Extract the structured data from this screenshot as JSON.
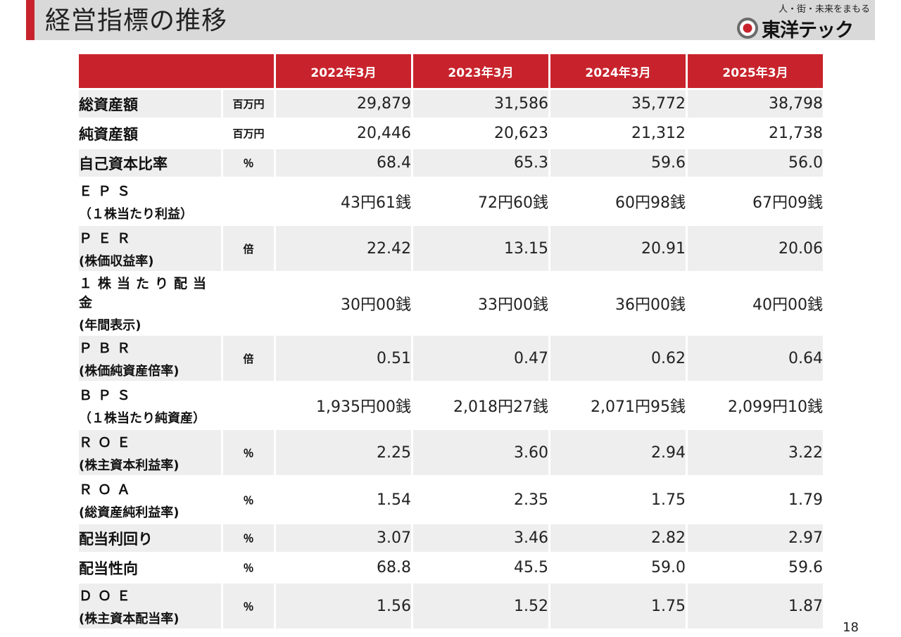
{
  "title": "経営指標の推移",
  "logo": {
    "slogan": "人・街・未来をまもる",
    "company": "東洋テック",
    "icon": "toyotec-logo-mark"
  },
  "colors": {
    "accent": "#c8232c",
    "header_bar": "#d9d9d9",
    "row_shade": "#eeeeee"
  },
  "table": {
    "headers": [
      "2022年3月",
      "2023年3月",
      "2024年3月",
      "2025年3月"
    ],
    "rows": [
      {
        "name1": "総資産額",
        "name2": "",
        "unit": "百万円",
        "values": [
          "29,879",
          "31,586",
          "35,772",
          "38,798"
        ]
      },
      {
        "name1": "純資産額",
        "name2": "",
        "unit": "百万円",
        "values": [
          "20,446",
          "20,623",
          "21,312",
          "21,738"
        ]
      },
      {
        "name1": "自己資本比率",
        "name2": "",
        "unit": "％",
        "values": [
          "68.4",
          "65.3",
          "59.6",
          "56.0"
        ]
      },
      {
        "name1": "ＥＰＳ",
        "name2": "（１株当たり利益）",
        "unit": "",
        "values": [
          "43円61銭",
          "72円60銭",
          "60円98銭",
          "67円09銭"
        ]
      },
      {
        "name1": "ＰＥＲ",
        "name2": "(株価収益率)",
        "unit": "倍",
        "values": [
          "22.42",
          "13.15",
          "20.91",
          "20.06"
        ]
      },
      {
        "name1": "１株当たり配当金",
        "name2": "(年間表示)",
        "unit": "",
        "values": [
          "30円00銭",
          "33円00銭",
          "36円00銭",
          "40円00銭"
        ]
      },
      {
        "name1": "ＰＢＲ",
        "name2": "(株価純資産倍率)",
        "unit": "倍",
        "values": [
          "0.51",
          "0.47",
          "0.62",
          "0.64"
        ]
      },
      {
        "name1": "ＢＰＳ",
        "name2": "（１株当たり純資産）",
        "unit": "",
        "values": [
          "1,935円00銭",
          "2,018円27銭",
          "2,071円95銭",
          "2,099円10銭"
        ]
      },
      {
        "name1": "ＲＯＥ",
        "name2": "(株主資本利益率)",
        "unit": "％",
        "values": [
          "2.25",
          "3.60",
          "2.94",
          "3.22"
        ]
      },
      {
        "name1": "ＲＯＡ",
        "name2": "(総資産純利益率)",
        "unit": "％",
        "values": [
          "1.54",
          "2.35",
          "1.75",
          "1.79"
        ]
      },
      {
        "name1": "配当利回り",
        "name2": "",
        "unit": "％",
        "values": [
          "3.07",
          "3.46",
          "2.82",
          "2.97"
        ]
      },
      {
        "name1": "配当性向",
        "name2": "",
        "unit": "％",
        "values": [
          "68.8",
          "45.5",
          "59.0",
          "59.6"
        ]
      },
      {
        "name1": "ＤＯＥ",
        "name2": "(株主資本配当率)",
        "unit": "％",
        "values": [
          "1.56",
          "1.52",
          "1.75",
          "1.87"
        ]
      }
    ]
  },
  "page_number": "18"
}
